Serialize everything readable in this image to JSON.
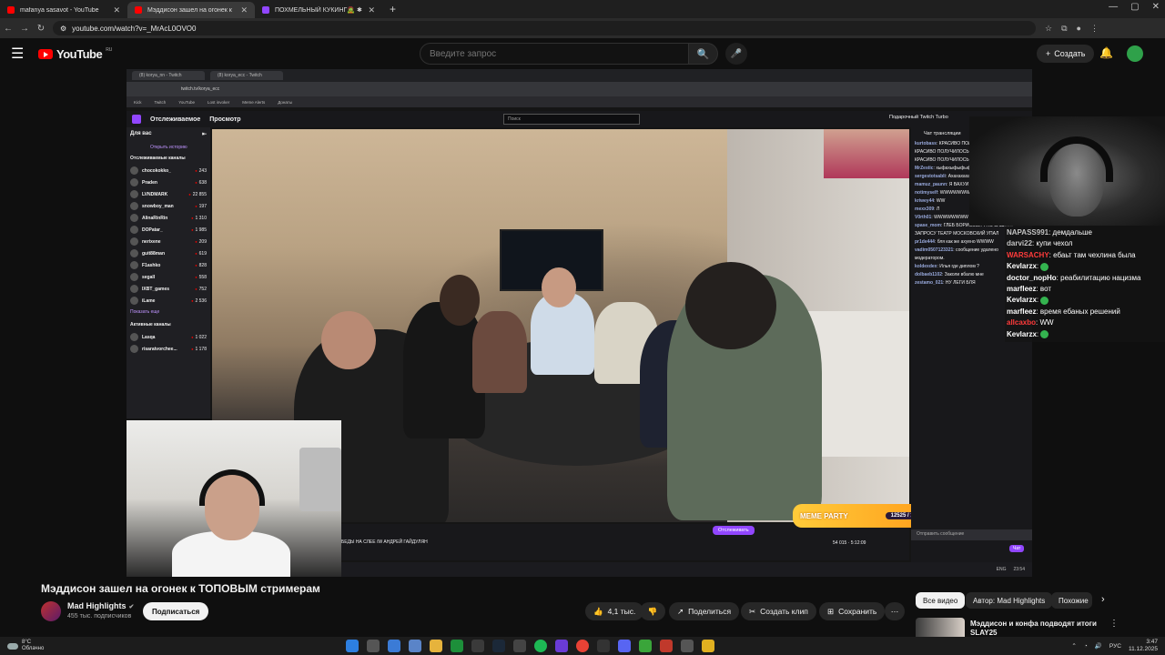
{
  "browser": {
    "tabs": [
      {
        "title": "mafanya sasavot - YouTube",
        "color": "#ff0000"
      },
      {
        "title": "Мэддисон зашел на огонек к",
        "color": "#ff0000"
      },
      {
        "title": "ПОХМЕЛЬНЫЙ КУКИНГ🧟 ✱",
        "color": "#9146ff"
      }
    ],
    "url": "youtube.com/watch?v=_MrAcL0OVO0"
  },
  "youtube": {
    "logo": "YouTube",
    "region": "RU",
    "search_placeholder": "Введите запрос",
    "create_label": "Создать"
  },
  "twitch": {
    "nav_following": "Отслеживаемое",
    "nav_browse": "Просмотр",
    "search_placeholder": "Поиск",
    "turbo": "Подарочный Twitch Turbo",
    "sidebar_title": "Для вас",
    "history_link": "Открыть историю",
    "followed_section": "Отслеживаемые каналы",
    "channels": [
      {
        "name": "chocokokko_",
        "viewers": "243"
      },
      {
        "name": "Praden",
        "viewers": "638"
      },
      {
        "name": "LVNDMARK",
        "viewers": "22 855"
      },
      {
        "name": "snowboy_man",
        "viewers": "197"
      },
      {
        "name": "AlinaRinRin",
        "viewers": "1 310"
      },
      {
        "name": "DOPatar_",
        "viewers": "1 985"
      },
      {
        "name": "nerixene",
        "viewers": "209"
      },
      {
        "name": "guit88man",
        "viewers": "619"
      },
      {
        "name": "F1ashko",
        "viewers": "828"
      },
      {
        "name": "segall",
        "viewers": "558"
      },
      {
        "name": "IXBT_games",
        "viewers": "752"
      },
      {
        "name": "iLame",
        "viewers": "2 536"
      }
    ],
    "show_more": "Показать еще",
    "active_section": "Активные каналы",
    "active_channels": [
      {
        "name": "Lasqa",
        "viewers": "1 022"
      },
      {
        "name": "risaratvorchee...",
        "viewers": "1 178"
      }
    ],
    "stream_title": "БЕДЫ НА СЛЕЕ /W АНДРЕЙ ГАЙДУЛЯН",
    "follow_btn": "Отслеживать",
    "viewers": "54 015",
    "uptime": "5:12:09",
    "chat_header": "Чат трансляции",
    "chat_input": "Отправить сообщение",
    "chat_send": "Чат",
    "chat_messages": [
      {
        "user": "kurtobass",
        "text": "КРАСИВО ПОЛУЧИЛОСЬ НАРИК ЖД"
      },
      {
        "user": "",
        "text": "КРАСИВО ПОЛУЧИЛОСЬ"
      },
      {
        "user": "",
        "text": "КРАСИВО ПОЛУЧИЛОСЬ НАРИК ЖД"
      },
      {
        "user": "MrZestic",
        "text": "хыфахыфыфыфы"
      },
      {
        "user": "sergestotsabli",
        "text": "Ахахахахахаха"
      },
      {
        "user": "mamuz_paunn",
        "text": "Я ВАХУИ"
      },
      {
        "user": "notimyself",
        "text": "WWWWWWW"
      },
      {
        "user": "kriwey44",
        "text": "WW"
      },
      {
        "user": "mexx309",
        "text": "Л"
      },
      {
        "user": "V0rth01",
        "text": "WWWWWWWW"
      },
      {
        "user": "spase_mom",
        "text": "ГЛЕБ БОРИСОВИЧ ПО ВАШЕМУ ЗАПРОСУ ТЕАТР МОСКОВСКИЙ УПАЛ"
      },
      {
        "user": "pr1de444",
        "text": "бля как же ахуено WWWW"
      },
      {
        "user": "vadim0507123321",
        "text": "сообщение удалено модератором."
      },
      {
        "user": "koldexdex",
        "text": "Илья где диплом ?"
      },
      {
        "user": "dolbaeb1102",
        "text": "Заколи вбалю мне"
      },
      {
        "user": "zestamo_021",
        "text": "НУ ЛЕГИ БЛЯ"
      }
    ],
    "meme_party": "MEME PARTY",
    "meme_score": "12525 / 14900"
  },
  "overlay_chat": [
    {
      "user": "NAPASS991",
      "text": "демдальше",
      "color": "#c3c3c3"
    },
    {
      "user": "darvi22",
      "text": "купи чехол",
      "color": "#c3c3c3"
    },
    {
      "user": "WARSACHY",
      "text": "ебаьт там чехлина была",
      "color": "#ff3b3b"
    },
    {
      "user": "Kevlarzx",
      "text": "",
      "color": "#ffffff",
      "emote": true
    },
    {
      "user": "doctor_nopHo",
      "text": "реабилитацию нацизма",
      "color": "#ffffff"
    },
    {
      "user": "marfleez",
      "text": "вот",
      "color": "#ffffff"
    },
    {
      "user": "Kevlarzx",
      "text": "",
      "color": "#ffffff",
      "emote": true
    },
    {
      "user": "marfleez",
      "text": "время ебаных решений",
      "color": "#ffffff"
    },
    {
      "user": "allcaxbo",
      "text": "WW",
      "color": "#ff3b3b"
    },
    {
      "user": "Kevlarzx",
      "text": "",
      "color": "#ffffff",
      "emote": true
    }
  ],
  "video": {
    "title": "Мэддисон зашел на огонек к ТОПОВЫМ стримерам",
    "channel": "Mad Highlights",
    "subscribers": "455 тыс. подписчиков",
    "subscribe": "Подписаться",
    "likes": "4,1 тыс.",
    "share": "Поделиться",
    "clip": "Создать клип",
    "save": "Сохранить"
  },
  "chips": [
    "Все видео",
    "Автор: Mad Highlights",
    "Похожие"
  ],
  "recommendation": {
    "title": "Мэддисон и конфа подводят итоги SLAY25"
  },
  "taskbar": {
    "temp": "8°C",
    "weather": "Облачно",
    "lang": "РУС",
    "time": "3:47",
    "date": "11.12.2025"
  },
  "colors": {
    "youtube_red": "#ff0000",
    "twitch_purple": "#9146ff",
    "accent_green": "#34b34f"
  }
}
